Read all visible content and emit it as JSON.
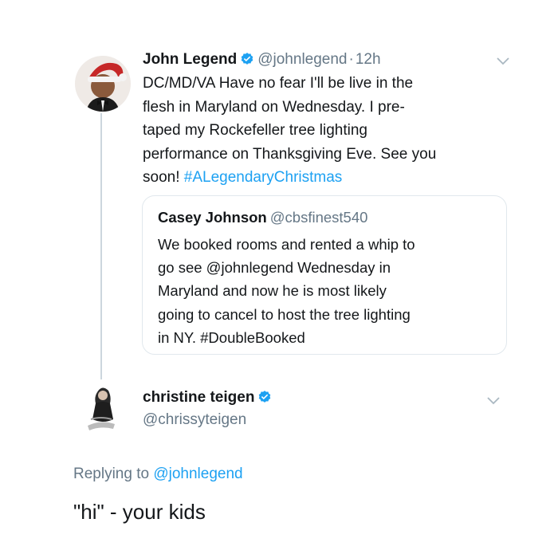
{
  "tweet": {
    "author": {
      "name": "John Legend",
      "handle": "@johnlegend",
      "separator": "·",
      "time": "12h",
      "avatar_icon": "avatar-santa-hat",
      "verified_icon": "verified-badge-icon"
    },
    "text_lines": [
      "DC/MD/VA Have no fear I'll be live in the",
      "flesh in Maryland on Wednesday. I pre-",
      "taped my Rockefeller tree lighting",
      "performance on Thanksgiving Eve. See you"
    ],
    "last_line_text": "soon! ",
    "hashtag": "#ALegendaryChristmas",
    "menu_icon": "chevron-down-icon"
  },
  "quote": {
    "name": "Casey Johnson",
    "handle": "@cbsfinest540",
    "text_lines": [
      "We booked rooms and rented a whip to",
      "go see @johnlegend Wednesday in",
      "Maryland and now he is most likely",
      "going to cancel to host the tree lighting",
      "in NY.  #DoubleBooked"
    ]
  },
  "reply": {
    "name": "christine teigen",
    "handle": "@chrissyteigen",
    "replying_prefix": "Replying to ",
    "replying_mention": "@johnlegend",
    "text": "\"hi\" - your kids",
    "menu_icon": "chevron-down-icon"
  },
  "colors": {
    "link": "#1da1f2",
    "secondary_text": "#657786",
    "primary_text": "#14171a",
    "border": "#e1e8ed",
    "thread_line": "#ccd6dd"
  }
}
